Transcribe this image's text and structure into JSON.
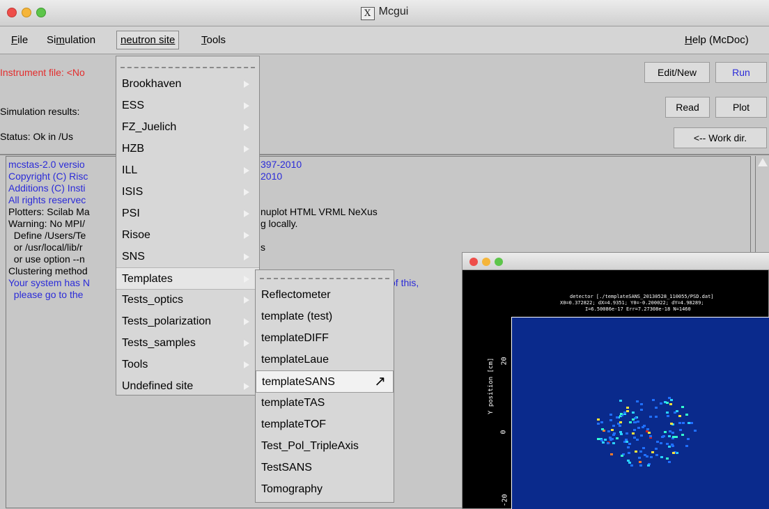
{
  "window": {
    "title": "Mcgui",
    "app_icon": "x11-icon"
  },
  "menubar": {
    "file": "File",
    "simulation": "Simulation",
    "neutron_site": "neutron site",
    "tools": "Tools",
    "help": "Help (McDoc)"
  },
  "info": {
    "instrument_file": "Instrument file: <No",
    "simulation_results": "Simulation results:",
    "status": "Status: Ok  in  /Us"
  },
  "buttons": {
    "edit_new": "Edit/New",
    "run": "Run",
    "read": "Read",
    "plot": "Plot",
    "work_dir": "<-- Work dir."
  },
  "colors": {
    "accent_blue": "#2b2bd8",
    "warning_red": "#e32d2d",
    "plot_bg": "#0a2a8c"
  },
  "log": {
    "lines": [
      {
        "left": "mcstas-2.0 versio",
        "right": "397-2010",
        "color": "blue"
      },
      {
        "left": "Copyright (C) Risc",
        "right": "2010",
        "color": "blue"
      },
      {
        "left": "Additions (C) Insti",
        "right": "",
        "color": "blue"
      },
      {
        "left": "All rights reservec",
        "right": "",
        "color": "blue"
      },
      {
        "left": "Plotters: Scilab Ma",
        "right": "nuplot HTML VRML NeXus",
        "color": "black"
      },
      {
        "left": "Warning: No MPI/",
        "right": "g locally.",
        "color": "black"
      },
      {
        "left": "  Define /Users/Te",
        "right": "",
        "color": "black"
      },
      {
        "left": "  or /usr/local/lib/r",
        "right": "s",
        "color": "black"
      },
      {
        "left": "  or use option --n",
        "right": "",
        "color": "black"
      },
      {
        "left": "Clustering method",
        "right": "",
        "color": "black"
      },
      {
        "left": "Your system has N",
        "right": "of this,",
        "color": "blue"
      },
      {
        "left": "  please go to the",
        "right": "",
        "color": "blue"
      }
    ]
  },
  "site_menu": {
    "items": [
      "Brookhaven",
      "ESS",
      "FZ_Juelich",
      "HZB",
      "ILL",
      "ISIS",
      "PSI",
      "Risoe",
      "SNS",
      "Templates",
      "Tests_optics",
      "Tests_polarization",
      "Tests_samples",
      "Tools",
      "Undefined site"
    ],
    "active": "Templates"
  },
  "templates_menu": {
    "items": [
      "Reflectometer",
      "template (test)",
      "templateDIFF",
      "templateLaue",
      "templateSANS",
      "templateTAS",
      "templateTOF",
      "Test_Pol_TripleAxis",
      "TestSANS",
      "Tomography"
    ],
    "selected": "templateSANS"
  },
  "plot_window": {
    "header_line1": "detector [./templateSANS_20130528_110055/PSD.dat]",
    "header_line2": "X0=0.372822; dX=4.9351; Y0=-0.200022; dY=4.98289;",
    "header_line3": "I=6.50086e-17 Err=7.27308e-18 N=1460",
    "ylabel": "Y position [cm]",
    "yticks": [
      "20",
      "0",
      "-20"
    ]
  }
}
